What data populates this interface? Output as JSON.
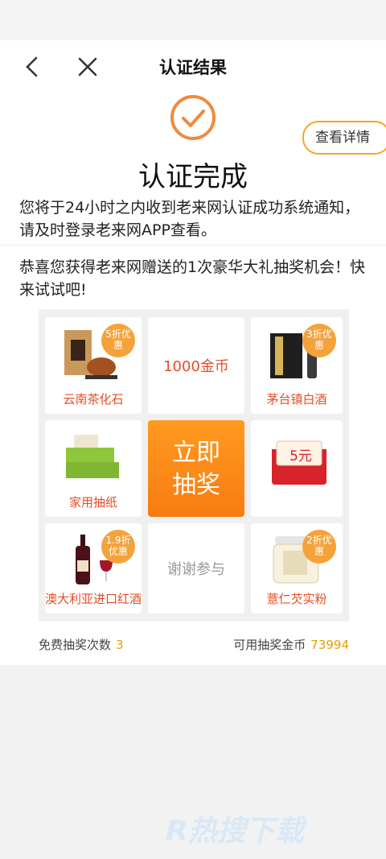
{
  "nav": {
    "title": "认证结果"
  },
  "result": {
    "detail_button": "查看详情",
    "title": "认证完成",
    "notice": "您将于24小时之内收到老来网认证成功系统通知，请及时登录老来网APP查看。"
  },
  "congrats": "恭喜您获得老来网赠送的1次豪华大礼抽奖机会！快来试试吧!",
  "lottery": {
    "prizes": [
      {
        "label": "云南茶化石",
        "tag": "5折优惠"
      },
      {
        "label": "1000金币"
      },
      {
        "label": "茅台镇白酒",
        "tag": "3折优惠"
      },
      {
        "label": "家用抽纸"
      },
      {
        "label": "5元",
        "kind": "红包"
      },
      {
        "label": "澳大利亚进口红酒",
        "tag": "1.9折优惠"
      },
      {
        "label": "谢谢参与"
      },
      {
        "label": "薏仁芡实粉",
        "tag": "2折优惠"
      }
    ],
    "draw_line1": "立即",
    "draw_line2": "抽奖"
  },
  "stats": {
    "free_label": "免费抽奖次数",
    "free_value": "3",
    "coins_label": "可用抽奖金币",
    "coins_value": "73994"
  },
  "watermark": "R热搜下载",
  "colors": {
    "accent": "#f5a623",
    "prize_text": "#e44d26",
    "draw_button": "#f97b12"
  }
}
